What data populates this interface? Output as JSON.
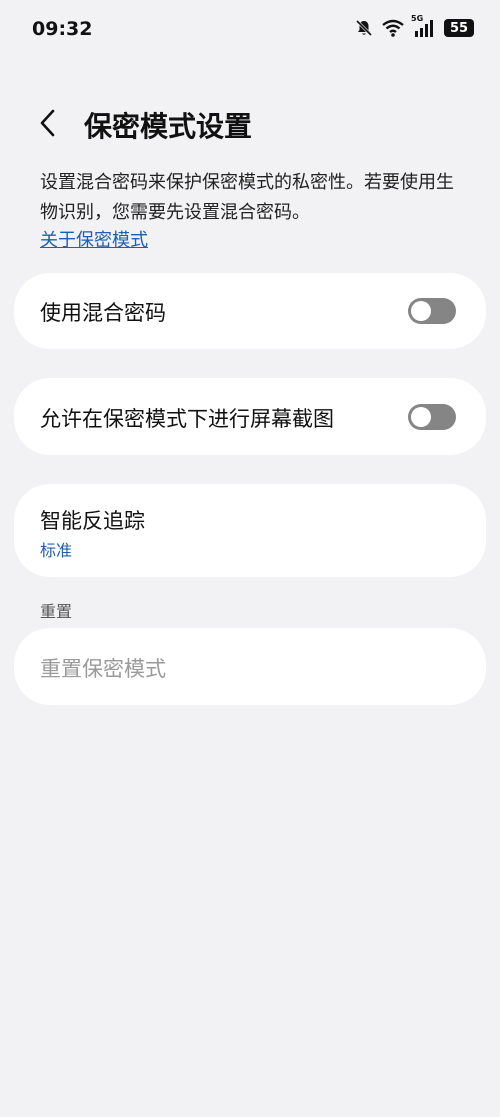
{
  "status_bar": {
    "time": "09:32",
    "battery": "55",
    "network": "5G",
    "icons": [
      "mute-bell-icon",
      "wifi-icon",
      "signal-icon",
      "battery-icon"
    ]
  },
  "header": {
    "title": "保密模式设置",
    "back_icon": "chevron-left-icon"
  },
  "description": {
    "text": "设置混合密码来保护保密模式的私密性。若要使用生物识别，您需要先设置混合密码。",
    "link": "关于保密模式"
  },
  "settings": {
    "mixed_password": {
      "label": "使用混合密码",
      "enabled": false
    },
    "screenshot": {
      "label": "允许在保密模式下进行屏幕截图",
      "enabled": false
    },
    "anti_tracking": {
      "label": "智能反追踪",
      "value": "标准"
    }
  },
  "reset_section": {
    "header": "重置",
    "item_label": "重置保密模式"
  },
  "colors": {
    "background": "#f2f2f4",
    "card": "#ffffff",
    "link": "#1f5fae",
    "toggle_off": "#858585"
  }
}
